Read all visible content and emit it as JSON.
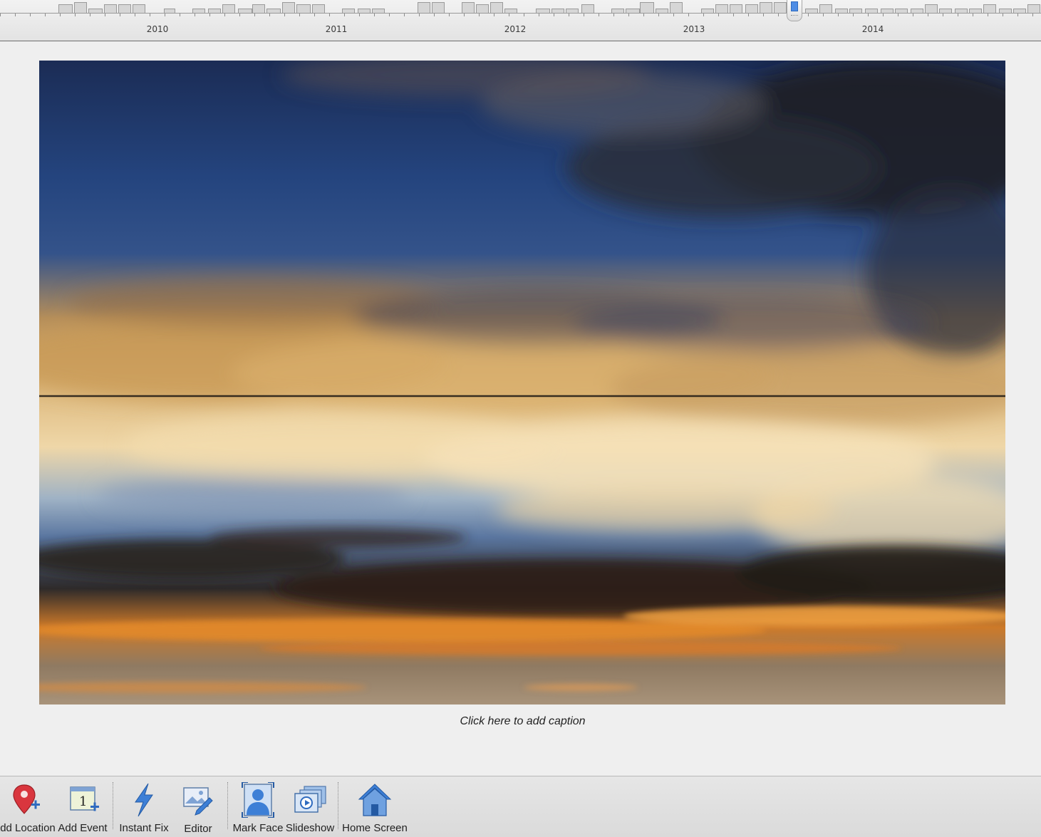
{
  "timeline": {
    "years": [
      "2010",
      "2011",
      "2012",
      "2013",
      "2014"
    ]
  },
  "photo": {
    "description_icon": "sunset-clouds-photo"
  },
  "caption": {
    "placeholder": "Click here to add caption"
  },
  "toolbar": {
    "add_location": "Add Location",
    "add_event": "Add Event",
    "instant_fix": "Instant Fix",
    "editor": "Editor",
    "mark_face": "Mark Face",
    "slideshow": "Slideshow",
    "home_screen": "Home Screen",
    "icons": {
      "add_location": "map-pin-plus-icon",
      "add_event": "calendar-plus-icon",
      "instant_fix": "lightning-icon",
      "editor": "photo-editor-icon",
      "mark_face": "face-frame-icon",
      "slideshow": "slideshow-icon",
      "home_screen": "home-icon"
    },
    "colors": {
      "accent_blue": "#3d7fd6",
      "pin_red": "#d9363e"
    }
  }
}
